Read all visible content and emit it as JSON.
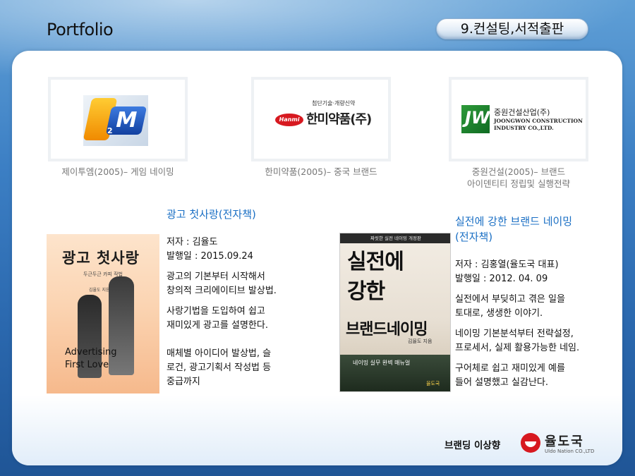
{
  "header": {
    "title": "Portfolio",
    "section_label": "9.컨설팅,서적출판"
  },
  "logos": [
    {
      "caption": "제이투엠(2005)– 게임 네이밍",
      "logo_text": "M",
      "logo_sub": "2"
    },
    {
      "caption": "한미약품(2005)– 중국 브랜드",
      "logo_small": "첨단기술·개량신약",
      "logo_badge": "Hanmi",
      "logo_name": "한미약품(주)"
    },
    {
      "caption_line1": "중원건설(2005)– 브랜드",
      "caption_line2": "아이덴티티 정립및 실행전략",
      "logo_ko": "중원건설산업(주)",
      "logo_en1": "JOONGWON CONSTRUCTION",
      "logo_en2": "INDUSTRY CO.,LTD."
    }
  ],
  "books": [
    {
      "title": "광고 첫사랑(전자책)",
      "author": "저자 : 김율도",
      "date": "발행일 : 2015.09.24",
      "desc1": [
        "광고의 기본부터 시작해서",
        "창의적 크리에이티브 발상법."
      ],
      "desc2": [
        "사랑기법을 도입하여 쉽고",
        "재미있게 광고를 설명한다."
      ],
      "desc3": [
        "매체별 아이디어 발상법, 슬",
        "로건, 광고기획서 작성법 등",
        "중급까지"
      ],
      "cover": {
        "title": "광고 첫사랑",
        "subtitle": "두근두근 카피 작법",
        "author": "김율도 지음",
        "en1": "Advertising",
        "en2": "First Love"
      }
    },
    {
      "title_line1": "실전에 강한 브랜드 네이밍",
      "title_line2": "(전자책)",
      "author": "저자 : 김홍열(율도국 대표)",
      "date": "발행일 : 2012. 04. 09",
      "desc1": [
        "실전에서 부딪히고 겪은 일을",
        "토대로, 생생한 이야기."
      ],
      "desc2": [
        "네이밍 기본분석부터 전략설정,",
        "프로세서, 실제 활용가능한 네임."
      ],
      "desc3": [
        "구어체로 쉽고 재미있게 예를",
        "들어 설명했고 실감난다."
      ],
      "cover": {
        "top": "짜릿한 실전 네이밍 개정판",
        "line1": "실전에",
        "line2": "강한",
        "line3": "브랜드네이밍",
        "author": "김율도 지음",
        "sub": "네이밍 실무 완벽 매뉴얼",
        "pub": "율도국"
      }
    }
  ],
  "footer": {
    "slogan": "브랜딩 이상향",
    "brand": "율도국",
    "brand_en": "Uldo Nation CO.,LTD"
  },
  "colors": {
    "title_blue": "#1a6fc4",
    "background_blue": "#3c7fc4",
    "accent_red": "#d71920"
  }
}
